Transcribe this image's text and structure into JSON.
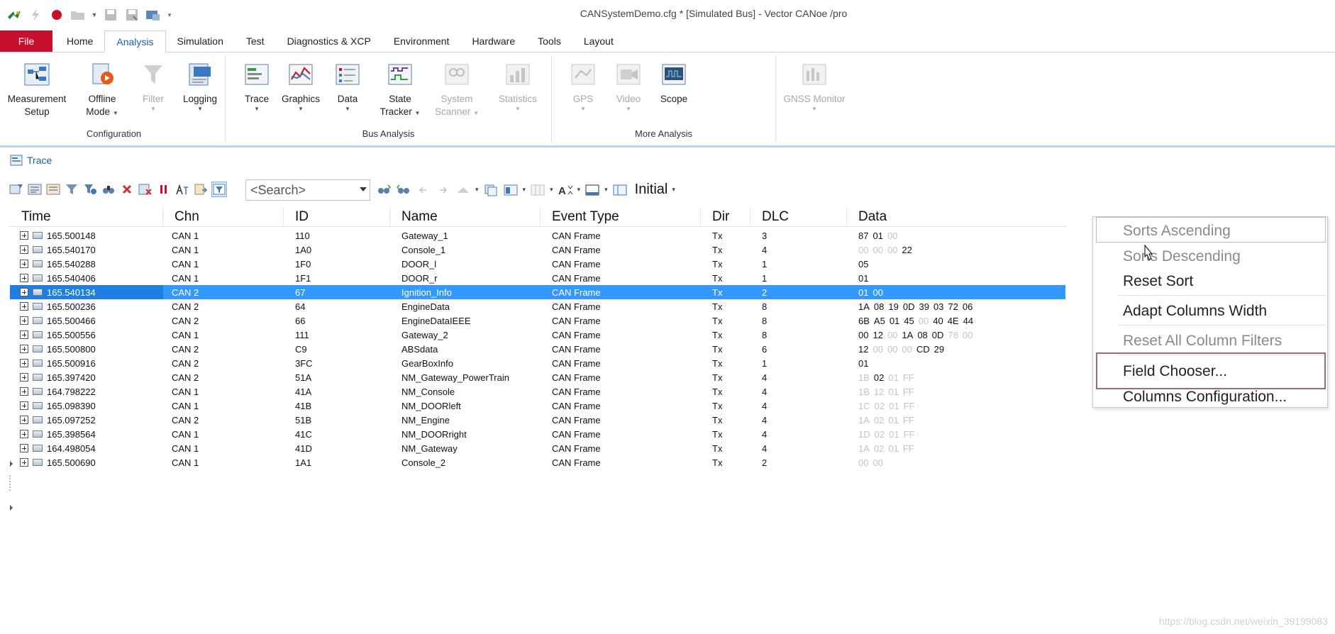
{
  "window": {
    "title": "CANSystemDemo.cfg * [Simulated Bus] - Vector CANoe /pro"
  },
  "qat": {
    "icons": [
      "canoe-logo-icon",
      "lightning-icon",
      "record-icon",
      "open-folder-icon",
      "save-icon",
      "save-as-icon",
      "config-icon",
      "qat-more-icon"
    ]
  },
  "ribbon": {
    "tabs": [
      "File",
      "Home",
      "Analysis",
      "Simulation",
      "Test",
      "Diagnostics & XCP",
      "Environment",
      "Hardware",
      "Tools",
      "Layout"
    ],
    "active_tab": "Analysis",
    "groups": [
      {
        "label": "Configuration",
        "buttons": [
          {
            "label1": "Measurement",
            "label2": "Setup",
            "enabled": true,
            "icon": "measurement-setup-icon"
          },
          {
            "label1": "Offline",
            "label2": "Mode",
            "enabled": true,
            "icon": "offline-mode-icon",
            "caret": true
          },
          {
            "label1": "Filter",
            "label2": "",
            "enabled": false,
            "icon": "filter-icon",
            "caret": true
          },
          {
            "label1": "Logging",
            "label2": "",
            "enabled": true,
            "icon": "logging-icon",
            "caret": true
          }
        ]
      },
      {
        "label": "Bus Analysis",
        "buttons": [
          {
            "label1": "Trace",
            "label2": "",
            "enabled": true,
            "icon": "trace-icon",
            "caret": true
          },
          {
            "label1": "Graphics",
            "label2": "",
            "enabled": true,
            "icon": "graphics-icon",
            "caret": true
          },
          {
            "label1": "Data",
            "label2": "",
            "enabled": true,
            "icon": "data-icon",
            "caret": true
          },
          {
            "label1": "State",
            "label2": "Tracker",
            "enabled": true,
            "icon": "state-tracker-icon",
            "caret": true
          },
          {
            "label1": "System",
            "label2": "Scanner",
            "enabled": false,
            "icon": "system-scanner-icon",
            "caret": true
          },
          {
            "label1": "Statistics",
            "label2": "",
            "enabled": false,
            "icon": "statistics-icon",
            "caret": true
          }
        ]
      },
      {
        "label": "More Analysis",
        "buttons": [
          {
            "label1": "GPS",
            "label2": "",
            "enabled": false,
            "icon": "gps-icon",
            "caret": true
          },
          {
            "label1": "Video",
            "label2": "",
            "enabled": false,
            "icon": "video-icon",
            "caret": true
          },
          {
            "label1": "Scope",
            "label2": "",
            "enabled": true,
            "icon": "scope-icon"
          }
        ]
      },
      {
        "label": "",
        "buttons": [
          {
            "label1": "GNSS Monitor",
            "label2": "",
            "enabled": false,
            "icon": "gnss-monitor-icon",
            "caret": true
          }
        ]
      }
    ]
  },
  "trace": {
    "title": "Trace",
    "search_placeholder": "<Search>",
    "layout_name": "Initial",
    "columns": [
      "Time",
      "Chn",
      "ID",
      "Name",
      "Event Type",
      "Dir",
      "DLC",
      "Data"
    ],
    "rows": [
      {
        "time": "165.500148",
        "chn": "CAN 1",
        "id": "110",
        "name": "Gateway_1",
        "event": "CAN Frame",
        "dir": "Tx",
        "dlc": "3",
        "data": [
          [
            "87",
            false
          ],
          [
            "01",
            false
          ],
          [
            "00",
            true
          ]
        ]
      },
      {
        "time": "165.540170",
        "chn": "CAN 1",
        "id": "1A0",
        "name": "Console_1",
        "event": "CAN Frame",
        "dir": "Tx",
        "dlc": "4",
        "data": [
          [
            "00",
            true
          ],
          [
            "00",
            true
          ],
          [
            "00",
            true
          ],
          [
            "22",
            false
          ]
        ]
      },
      {
        "time": "165.540288",
        "chn": "CAN 1",
        "id": "1F0",
        "name": "DOOR_l",
        "event": "CAN Frame",
        "dir": "Tx",
        "dlc": "1",
        "data": [
          [
            "05",
            false
          ]
        ]
      },
      {
        "time": "165.540406",
        "chn": "CAN 1",
        "id": "1F1",
        "name": "DOOR_r",
        "event": "CAN Frame",
        "dir": "Tx",
        "dlc": "1",
        "data": [
          [
            "01",
            false
          ]
        ]
      },
      {
        "time": "165.540134",
        "chn": "CAN 2",
        "id": "67",
        "name": "Ignition_Info",
        "event": "CAN Frame",
        "dir": "Tx",
        "dlc": "2",
        "data": [
          [
            "01",
            false
          ],
          [
            "00",
            false
          ]
        ],
        "selected": true
      },
      {
        "time": "165.500236",
        "chn": "CAN 2",
        "id": "64",
        "name": "EngineData",
        "event": "CAN Frame",
        "dir": "Tx",
        "dlc": "8",
        "data": [
          [
            "1A",
            false
          ],
          [
            "08",
            false
          ],
          [
            "19",
            false
          ],
          [
            "0D",
            false
          ],
          [
            "39",
            false
          ],
          [
            "03",
            false
          ],
          [
            "72",
            false
          ],
          [
            "06",
            false
          ]
        ]
      },
      {
        "time": "165.500466",
        "chn": "CAN 2",
        "id": "66",
        "name": "EngineDataIEEE",
        "event": "CAN Frame",
        "dir": "Tx",
        "dlc": "8",
        "data": [
          [
            "6B",
            false
          ],
          [
            "A5",
            false
          ],
          [
            "01",
            false
          ],
          [
            "45",
            false
          ],
          [
            "00",
            true
          ],
          [
            "40",
            false
          ],
          [
            "4E",
            false
          ],
          [
            "44",
            false
          ]
        ]
      },
      {
        "time": "165.500556",
        "chn": "CAN 1",
        "id": "111",
        "name": "Gateway_2",
        "event": "CAN Frame",
        "dir": "Tx",
        "dlc": "8",
        "data": [
          [
            "00",
            false
          ],
          [
            "12",
            false
          ],
          [
            "00",
            true
          ],
          [
            "1A",
            false
          ],
          [
            "08",
            false
          ],
          [
            "0D",
            false
          ],
          [
            "78",
            true
          ],
          [
            "00",
            true
          ]
        ]
      },
      {
        "time": "165.500800",
        "chn": "CAN 2",
        "id": "C9",
        "name": "ABSdata",
        "event": "CAN Frame",
        "dir": "Tx",
        "dlc": "6",
        "data": [
          [
            "12",
            false
          ],
          [
            "00",
            true
          ],
          [
            "00",
            true
          ],
          [
            "00",
            true
          ],
          [
            "CD",
            false
          ],
          [
            "29",
            false
          ]
        ]
      },
      {
        "time": "165.500916",
        "chn": "CAN 2",
        "id": "3FC",
        "name": "GearBoxInfo",
        "event": "CAN Frame",
        "dir": "Tx",
        "dlc": "1",
        "data": [
          [
            "01",
            false
          ]
        ]
      },
      {
        "time": "165.397420",
        "chn": "CAN 2",
        "id": "51A",
        "name": "NM_Gateway_PowerTrain",
        "event": "CAN Frame",
        "dir": "Tx",
        "dlc": "4",
        "data": [
          [
            "1B",
            true
          ],
          [
            "02",
            false
          ],
          [
            "01",
            true
          ],
          [
            "FF",
            true
          ]
        ]
      },
      {
        "time": "164.798222",
        "chn": "CAN 1",
        "id": "41A",
        "name": "NM_Console",
        "event": "CAN Frame",
        "dir": "Tx",
        "dlc": "4",
        "data": [
          [
            "1B",
            true
          ],
          [
            "12",
            true
          ],
          [
            "01",
            true
          ],
          [
            "FF",
            true
          ]
        ]
      },
      {
        "time": "165.098390",
        "chn": "CAN 1",
        "id": "41B",
        "name": "NM_DOORleft",
        "event": "CAN Frame",
        "dir": "Tx",
        "dlc": "4",
        "data": [
          [
            "1C",
            true
          ],
          [
            "02",
            true
          ],
          [
            "01",
            true
          ],
          [
            "FF",
            true
          ]
        ]
      },
      {
        "time": "165.097252",
        "chn": "CAN 2",
        "id": "51B",
        "name": "NM_Engine",
        "event": "CAN Frame",
        "dir": "Tx",
        "dlc": "4",
        "data": [
          [
            "1A",
            true
          ],
          [
            "02",
            true
          ],
          [
            "01",
            true
          ],
          [
            "FF",
            true
          ]
        ]
      },
      {
        "time": "165.398564",
        "chn": "CAN 1",
        "id": "41C",
        "name": "NM_DOORright",
        "event": "CAN Frame",
        "dir": "Tx",
        "dlc": "4",
        "data": [
          [
            "1D",
            true
          ],
          [
            "02",
            true
          ],
          [
            "01",
            true
          ],
          [
            "FF",
            true
          ]
        ]
      },
      {
        "time": "164.498054",
        "chn": "CAN 1",
        "id": "41D",
        "name": "NM_Gateway",
        "event": "CAN Frame",
        "dir": "Tx",
        "dlc": "4",
        "data": [
          [
            "1A",
            true
          ],
          [
            "02",
            true
          ],
          [
            "01",
            true
          ],
          [
            "FF",
            true
          ]
        ]
      },
      {
        "time": "165.500690",
        "chn": "CAN 1",
        "id": "1A1",
        "name": "Console_2",
        "event": "CAN Frame",
        "dir": "Tx",
        "dlc": "2",
        "data": [
          [
            "00",
            true
          ],
          [
            "00",
            true
          ]
        ]
      }
    ]
  },
  "context_menu": {
    "items": [
      {
        "label": "Sorts Ascending",
        "enabled": false
      },
      {
        "label": "Sorts Descending",
        "enabled": false
      },
      {
        "label": "Reset Sort",
        "enabled": true
      },
      {
        "label": "Adapt Columns Width",
        "enabled": true
      },
      {
        "label": "Reset All Column Filters",
        "enabled": false
      },
      {
        "label": "Field Chooser...",
        "enabled": true,
        "highlighted": true
      },
      {
        "label": "Columns Configuration...",
        "enabled": true
      }
    ]
  },
  "watermark": "https://blog.csdn.net/weixin_39199083",
  "colors": {
    "accent": "#1a5fa8",
    "file_tab": "#c8102e",
    "selection": "#3399ff",
    "highlight_border": "#9b6b7c"
  }
}
